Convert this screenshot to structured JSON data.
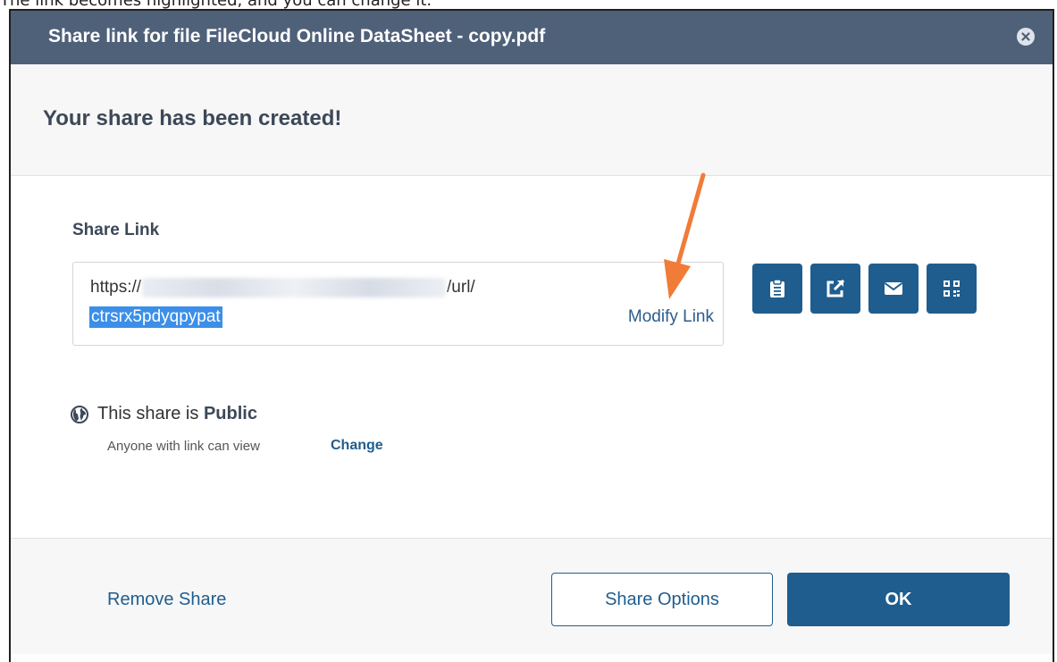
{
  "caption": "The link becomes highlighted, and you can change it.",
  "dialog": {
    "title": "Share link for file FileCloud Online DataSheet - copy.pdf",
    "close_icon": "close-circle-icon",
    "heading": "Your share has been created!"
  },
  "share_link": {
    "label": "Share Link",
    "url_prefix": "https://",
    "url_suffix": "/url/",
    "url_token": "ctrsrx5pdyqpypat",
    "modify_label": "Modify Link",
    "action_icons": [
      "clipboard-icon",
      "open-external-icon",
      "email-icon",
      "qr-code-icon"
    ]
  },
  "visibility": {
    "prefix": "This share is",
    "status": "Public",
    "description": "Anyone with link can view",
    "change_label": "Change"
  },
  "footer": {
    "remove_label": "Remove Share",
    "options_label": "Share Options",
    "ok_label": "OK"
  },
  "colors": {
    "title_bar": "#4f6079",
    "primary": "#1f5d8f",
    "selection": "#3b8fe8",
    "annotation_arrow": "#f07c38"
  }
}
